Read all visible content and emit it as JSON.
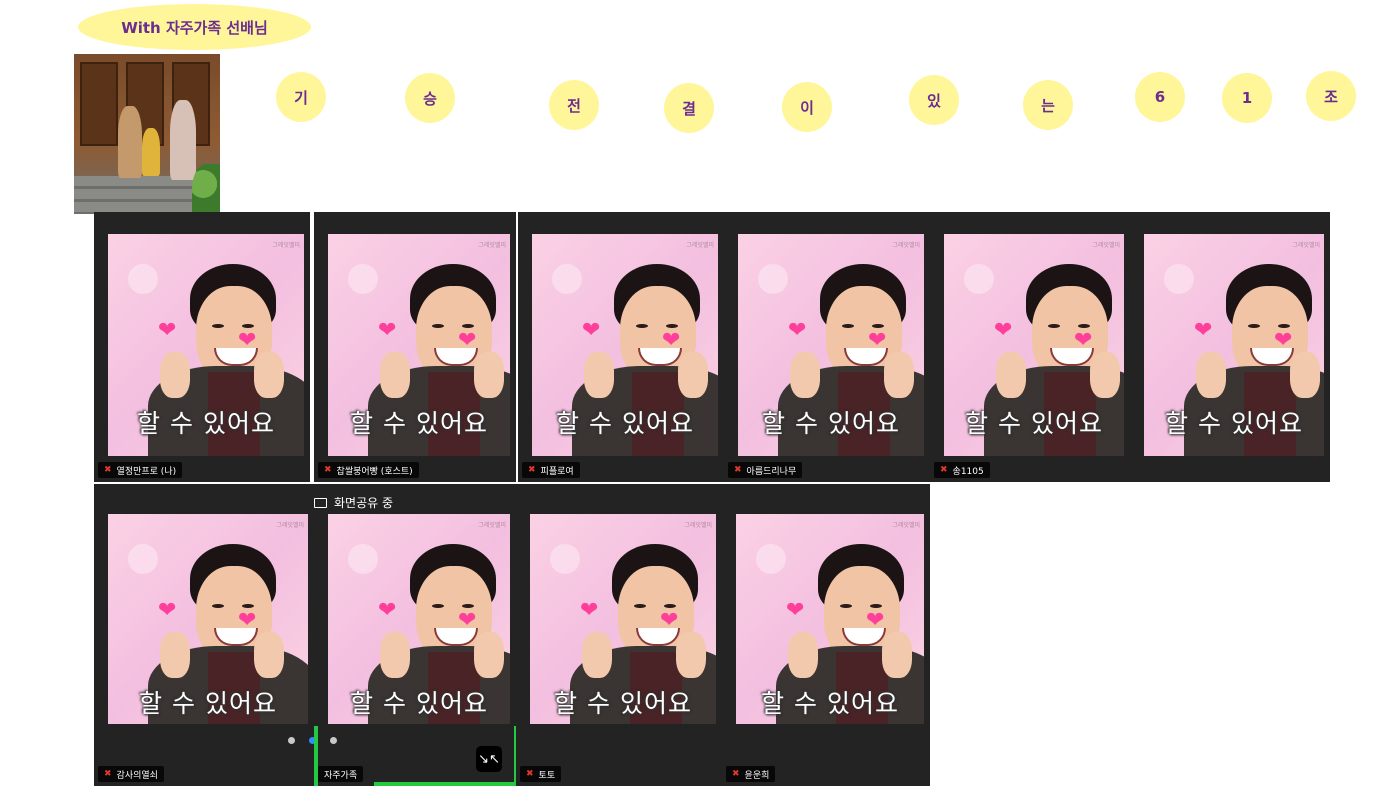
{
  "banner": {
    "text": "With 자주가족 선배님"
  },
  "bubbles": [
    "기",
    "승",
    "전",
    "결",
    "이",
    "있",
    "는",
    "6",
    "1",
    "조"
  ],
  "caption": "할 수 있어요",
  "watermark": "그레잇멜미",
  "tiles": [
    {
      "name": "열정만프로 (나)",
      "muted": true
    },
    {
      "name": "찹쌀붕어빵 (호스트)",
      "muted": true
    },
    {
      "name": "피플로여",
      "muted": true
    },
    {
      "name": "아름드리나무",
      "muted": true
    },
    {
      "name": "송1105",
      "muted": true
    },
    {
      "name": "",
      "muted": false
    },
    {
      "name": "감사의열쇠",
      "muted": true
    },
    {
      "name": "자주가족",
      "muted": false
    },
    {
      "name": "토토",
      "muted": true
    },
    {
      "name": "윤운희",
      "muted": true
    }
  ],
  "screen_share": {
    "label": "화면공유 중"
  },
  "pager": {
    "dots": 3,
    "active": 1
  },
  "colors": {
    "bubble": "#fff69a",
    "bubble_text": "#6b2d8f",
    "speaker_highlight": "#23c843",
    "tile_bg": "#232323"
  }
}
